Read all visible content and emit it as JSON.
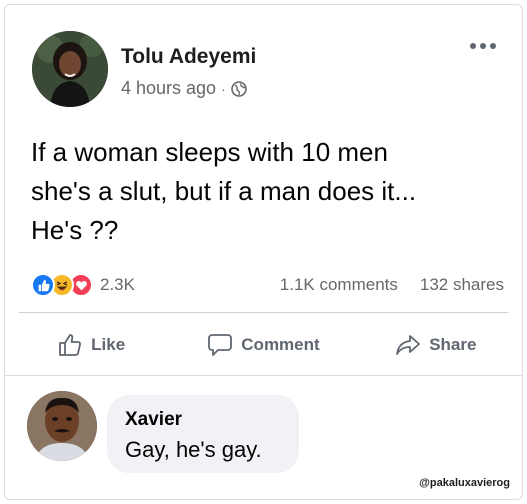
{
  "post": {
    "author": "Tolu Adeyemi",
    "time": "4 hours ago",
    "separator": "·",
    "text": "If a woman sleeps with 10 men\nshe's a slut, but if a man does it...\nHe's ??",
    "reactions_count": "2.3K",
    "comments_count": "1.1K comments",
    "shares_count": "132 shares",
    "reaction_icons": [
      "like-icon",
      "haha-icon",
      "love-icon"
    ]
  },
  "actions": {
    "like_label": "Like",
    "comment_label": "Comment",
    "share_label": "Share"
  },
  "comment": {
    "author": "Xavier",
    "text": "Gay, he's gay."
  },
  "watermark": "@pakaluxavierog",
  "colors": {
    "like_blue": "#1877f2",
    "haha_yellow": "#f7b928",
    "love_red": "#f33e58",
    "secondary_text": "#65676b",
    "bubble_bg": "#f0f2f5"
  }
}
